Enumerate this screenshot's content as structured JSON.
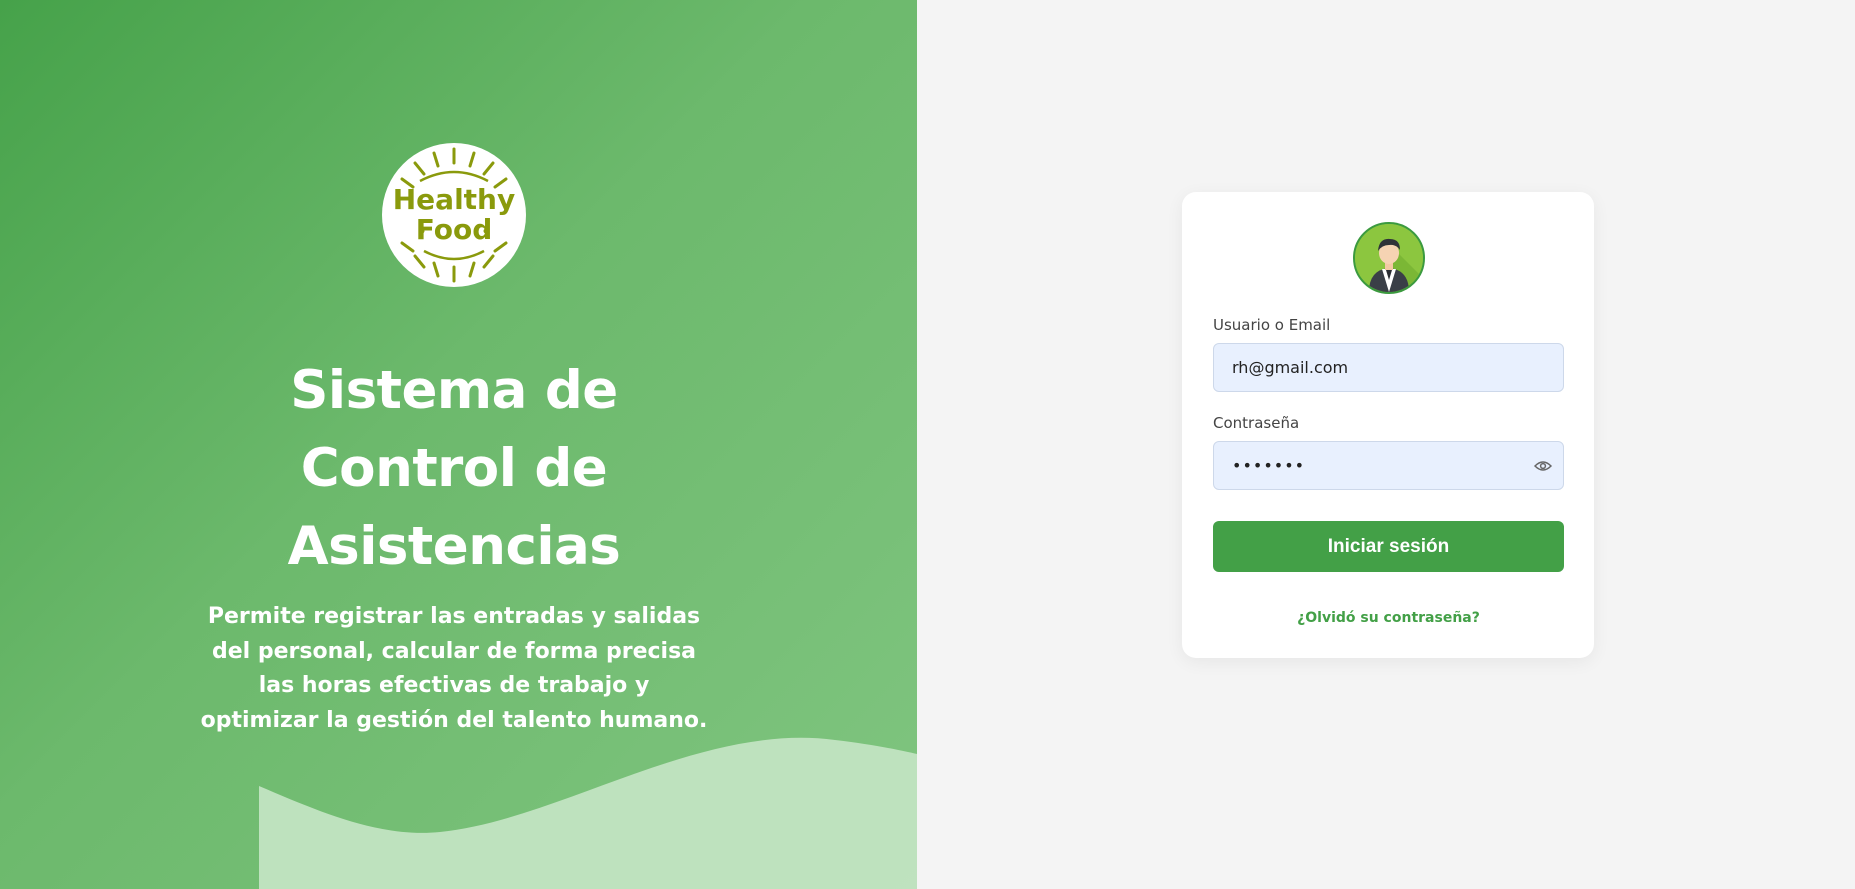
{
  "colors": {
    "brand_green": "#43a047",
    "logo_olive": "#8a9a0c",
    "input_bg": "#e8f0fe",
    "right_bg": "#f4f4f4"
  },
  "hero": {
    "logo_line1": "Healthy",
    "logo_line2": "Food",
    "title_line1": "Sistema de",
    "title_line2": "Control de",
    "title_line3": "Asistencias",
    "desc_line1": "Permite registrar las entradas y salidas",
    "desc_line2": "del personal, calcular de forma precisa",
    "desc_line3": "las horas efectivas de trabajo y",
    "desc_line4": "optimizar la gestión del talento humano."
  },
  "login": {
    "avatar_icon": "user-avatar-icon",
    "user_label": "Usuario o Email",
    "user_value": "rh@gmail.com",
    "password_label": "Contraseña",
    "password_value": "•••••••",
    "eye_icon": "eye-icon",
    "submit_label": "Iniciar sesión",
    "forgot_label": "¿Olvidó su contraseña?"
  }
}
